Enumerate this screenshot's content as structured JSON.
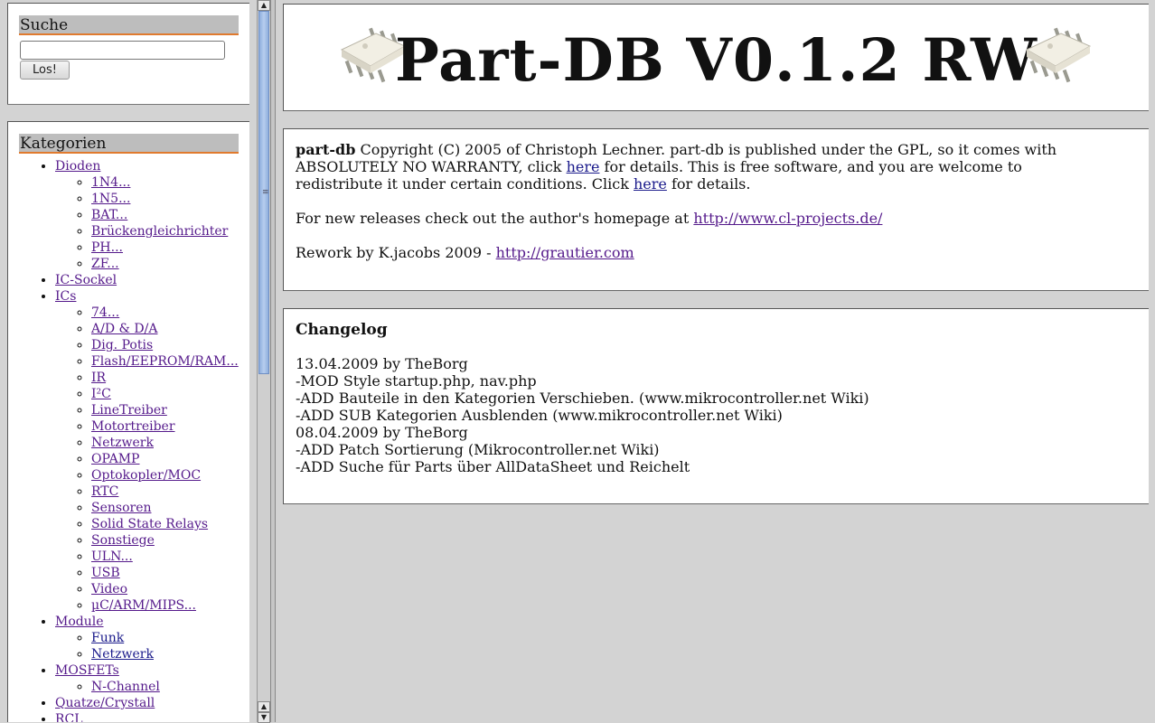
{
  "search": {
    "heading": "Suche",
    "input_value": "",
    "button_label": "Los!"
  },
  "categories": {
    "heading": "Kategorien",
    "items": [
      {
        "label": "Dioden",
        "children": [
          "1N4...",
          "1N5...",
          "BAT...",
          "Brückengleichrichter",
          "PH...",
          "ZF..."
        ]
      },
      {
        "label": "IC-Sockel",
        "children": []
      },
      {
        "label": "ICs",
        "children": [
          "74...",
          "A/D & D/A",
          "Dig. Potis",
          "Flash/EEPROM/RAM...",
          "IR",
          "I²C",
          "LineTreiber",
          "Motortreiber",
          "Netzwerk",
          "OPAMP",
          "Optokopler/MOC",
          "RTC",
          "Sensoren",
          "Solid State Relays",
          "Sonstiege",
          "ULN...",
          "USB",
          "Video",
          "µC/ARM/MIPS..."
        ]
      },
      {
        "label": "Module",
        "children": [
          "Funk",
          "Netzwerk"
        ]
      },
      {
        "label": "MOSFETs",
        "children": [
          "N-Channel"
        ]
      },
      {
        "label": "Quatze/Crystall",
        "children": []
      },
      {
        "label": "RCL",
        "children": []
      }
    ]
  },
  "header": {
    "title": "Part-DB V0.1.2 RW",
    "left_icon": "ic-chip-icon",
    "right_icon": "ic-chip-icon"
  },
  "info": {
    "brand": "part-db",
    "line1_a": " Copyright (C) 2005 of Christoph Lechner. part-db is published under the GPL, so it comes with ABSOLUTELY NO WARRANTY, click ",
    "link_here1": "here",
    "line1_b": " for details. This is free software, and you are welcome to redistribute it under certain conditions. Click ",
    "link_here2": "here",
    "line1_c": " for details.",
    "releases_text": "For new releases check out the author's homepage at ",
    "releases_link": "http://www.cl-projects.de/",
    "rework_text": "Rework by K.jacobs 2009 - ",
    "rework_link": "http://grautier.com"
  },
  "changelog": {
    "title": "Changelog",
    "lines": [
      "13.04.2009 by TheBorg",
      "-MOD Style startup.php, nav.php",
      "-ADD Bauteile in den Kategorien Verschieben. (www.mikrocontroller.net Wiki)",
      "-ADD SUB Kategorien Ausblenden (www.mikrocontroller.net Wiki)",
      "08.04.2009 by TheBorg",
      "-ADD Patch Sortierung (Mikrocontroller.net Wiki)",
      "-ADD Suche für Parts über AllDataSheet und Reichelt"
    ]
  }
}
